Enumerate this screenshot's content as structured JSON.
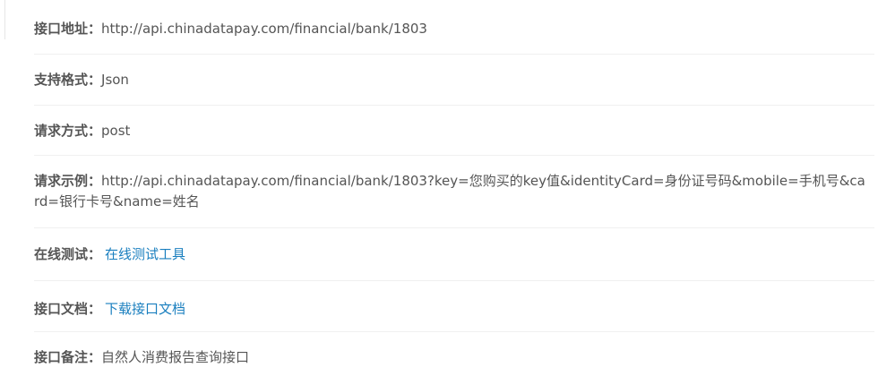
{
  "rows": [
    {
      "label": "接口地址：",
      "value": "http://api.chinadatapay.com/financial/bank/1803"
    },
    {
      "label": "支持格式：",
      "value": "Json"
    },
    {
      "label": "请求方式：",
      "value": "post"
    },
    {
      "label": "请求示例：",
      "value": "http://api.chinadatapay.com/financial/bank/1803?key=您购买的key值&identityCard=身份证号码&mobile=手机号&card=银行卡号&name=姓名"
    },
    {
      "label": "在线测试：",
      "link": "在线测试工具"
    },
    {
      "label": "接口文档：",
      "link": "下载接口文档"
    },
    {
      "label": "接口备注：",
      "value": "自然人消费报告查询接口"
    }
  ]
}
